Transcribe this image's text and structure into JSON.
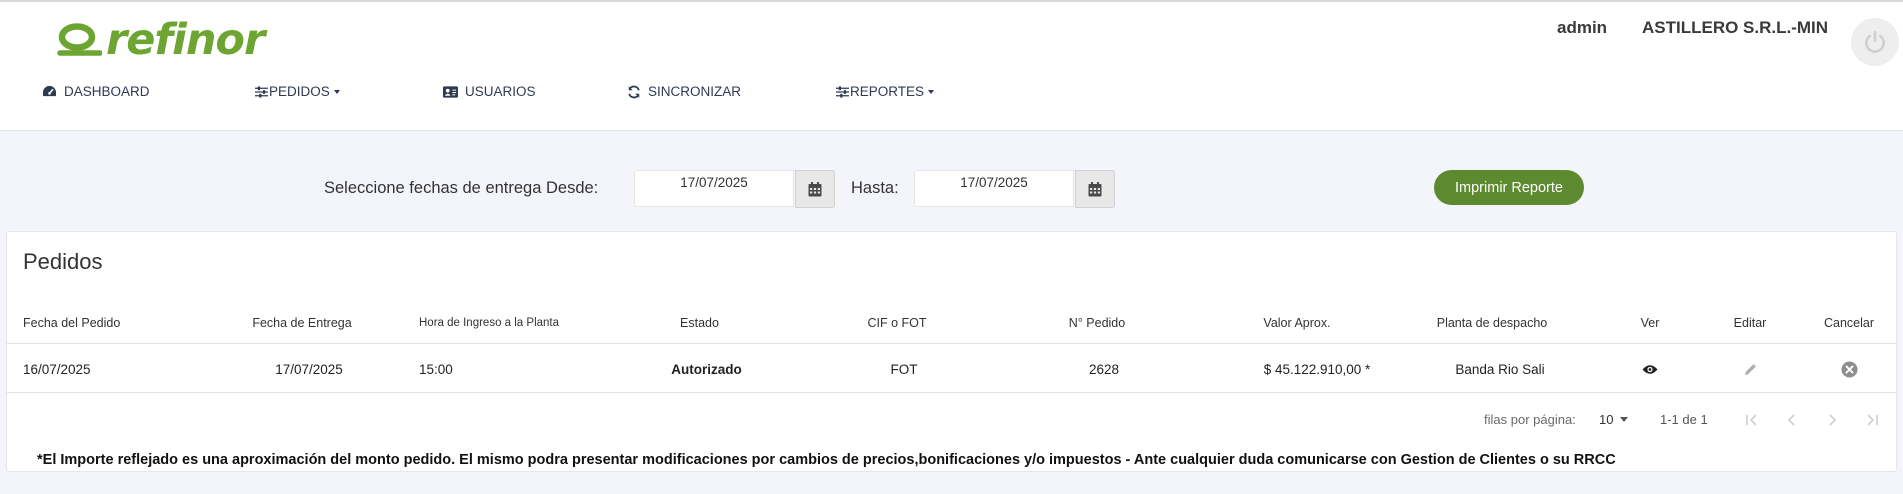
{
  "header": {
    "logo_text": "refinor",
    "user": "admin",
    "company": "ASTILLERO S.R.L.-MIN",
    "power_icon": "power-icon"
  },
  "nav": {
    "dashboard": "DASHBOARD",
    "pedidos": "PEDIDOS",
    "usuarios": "USUARIOS",
    "sincronizar": "SINCRONIZAR",
    "reportes": "REPORTES"
  },
  "filters": {
    "desde_label": "Seleccione fechas de entrega Desde:",
    "desde_value": "17/07/2025",
    "hasta_label": "Hasta:",
    "hasta_value": "17/07/2025",
    "print_label": "Imprimir Reporte"
  },
  "orders": {
    "title": "Pedidos",
    "columns": {
      "fecha_pedido": "Fecha del Pedido",
      "fecha_entrega": "Fecha de Entrega",
      "hora_ingreso": "Hora de Ingreso a la Planta",
      "estado": "Estado",
      "cif_fot": "CIF o FOT",
      "nro_pedido": "N° Pedido",
      "valor": "Valor Aprox.",
      "planta": "Planta de despacho",
      "ver": "Ver",
      "editar": "Editar",
      "cancelar": "Cancelar"
    },
    "rows": [
      {
        "fecha_pedido": "16/07/2025",
        "fecha_entrega": "17/07/2025",
        "hora_ingreso": "15:00",
        "estado": "Autorizado",
        "cif_fot": "FOT",
        "nro_pedido": "2628",
        "valor": "$ 45.122.910,00 *",
        "planta": "Banda Rio Sali"
      }
    ]
  },
  "pagination": {
    "rows_per_page_label": "filas por página:",
    "rows_per_page": "10",
    "range": "1-1 de 1"
  },
  "footnote": "*El Importe reflejado es una aproximación del monto pedido. El mismo podra presentar modificaciones por cambios de precios,bonificaciones y/o impuestos - Ante cualquier duda comunicarse con Gestion de Clientes o su RRCC",
  "colors": {
    "brand_green": "#6ca531",
    "button_green": "#5e8a2f",
    "background": "#f4f5fb",
    "nav_text": "#2e3a52"
  }
}
